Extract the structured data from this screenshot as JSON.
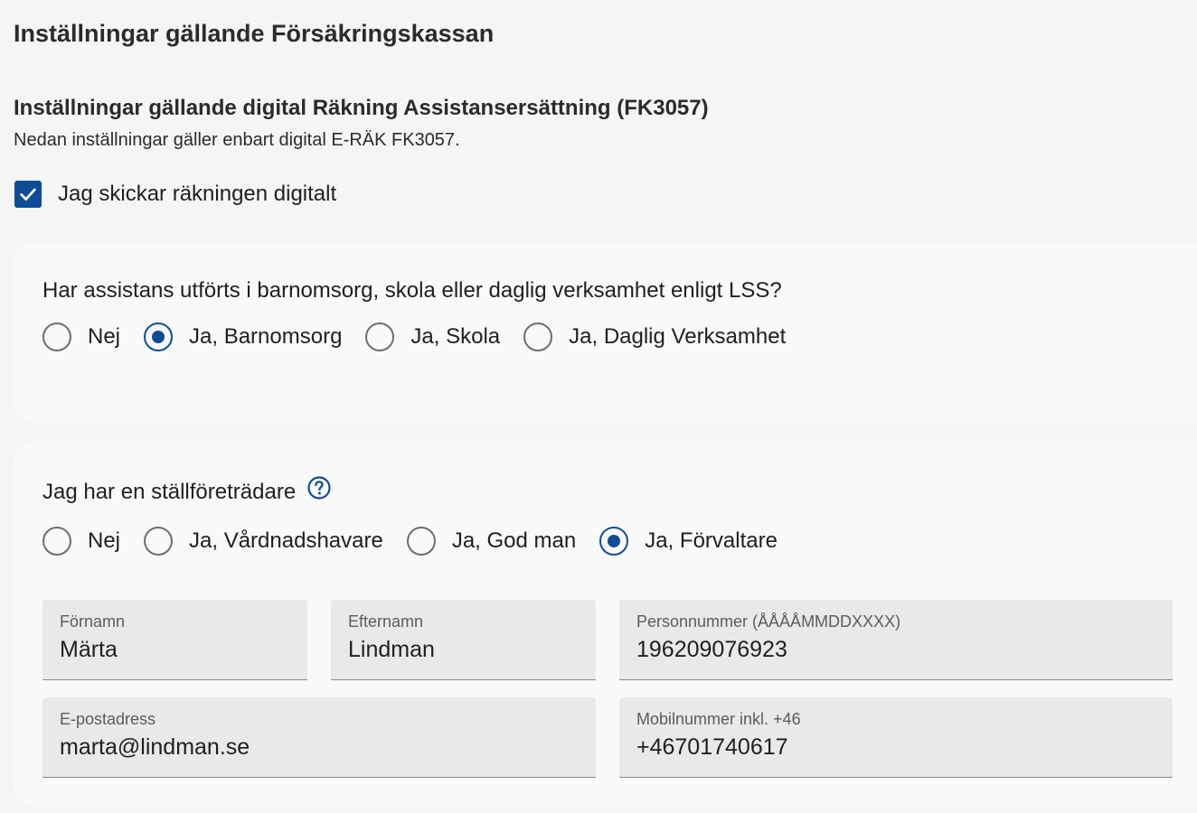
{
  "page": {
    "title": "Inställningar gällande Försäkringskassan"
  },
  "section": {
    "title": "Inställningar gällande digital Räkning Assistansersättning (FK3057)",
    "subtitle": "Nedan inställningar gäller enbart digital E-RÄK FK3057."
  },
  "digital_checkbox": {
    "label": "Jag skickar räkningen digitalt",
    "checked": true
  },
  "assistance_question": {
    "label": "Har assistans utförts i barnomsorg, skola eller daglig verksamhet enligt LSS?",
    "options": [
      {
        "label": "Nej",
        "checked": false
      },
      {
        "label": "Ja, Barnomsorg",
        "checked": true
      },
      {
        "label": "Ja, Skola",
        "checked": false
      },
      {
        "label": "Ja, Daglig Verksamhet",
        "checked": false
      }
    ]
  },
  "representative_question": {
    "label": "Jag har en ställföreträdare",
    "help_icon": "help-circle-icon",
    "options": [
      {
        "label": "Nej",
        "checked": false
      },
      {
        "label": "Ja, Vårdnadshavare",
        "checked": false
      },
      {
        "label": "Ja, God man",
        "checked": false
      },
      {
        "label": "Ja, Förvaltare",
        "checked": true
      }
    ]
  },
  "fields": {
    "first_name": {
      "label": "Förnamn",
      "value": "Märta"
    },
    "last_name": {
      "label": "Efternamn",
      "value": "Lindman"
    },
    "personal_number": {
      "label": "Personnummer (ÅÅÅÅMMDDXXXX)",
      "value": "196209076923"
    },
    "email": {
      "label": "E-postadress",
      "value": "marta@lindman.se"
    },
    "mobile": {
      "label": "Mobilnummer inkl. +46",
      "value": "+46701740617"
    }
  },
  "colors": {
    "accent": "#0f4c96",
    "background": "#f5f5f5",
    "card": "#f9f9f9",
    "field": "#e9e9e9"
  }
}
